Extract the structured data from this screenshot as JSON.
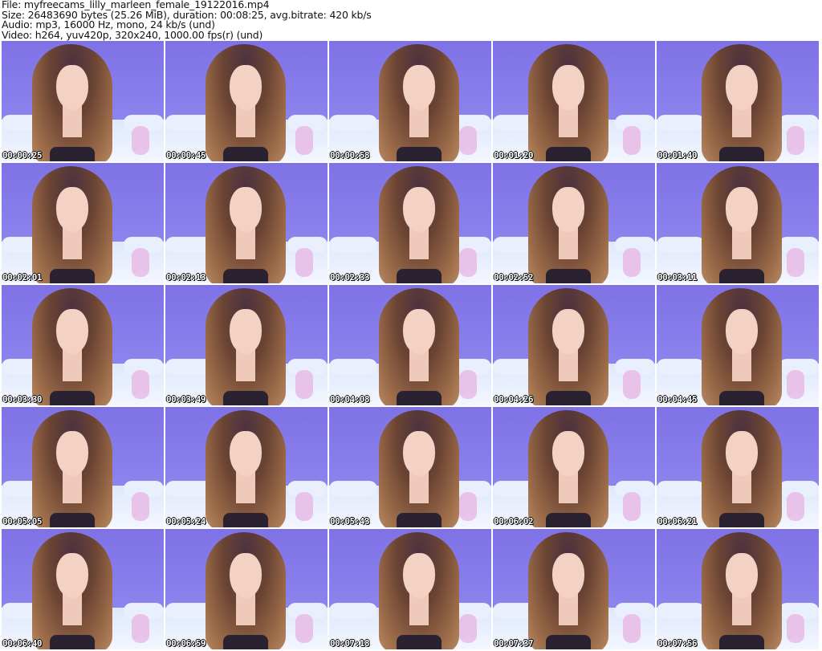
{
  "header": {
    "file": "File: myfreecams_lilly_marleen_female_19122016.mp4",
    "size": "Size: 26483690 bytes (25.26 MiB), duration: 00:08:25, avg.bitrate: 420 kb/s",
    "audio": "Audio: mp3, 16000 Hz, mono, 24 kb/s (und)",
    "video": "Video: h264, yuv420p, 320x240, 1000.00 fps(r) (und)"
  },
  "thumbnails": [
    {
      "timestamp": "00:00:25"
    },
    {
      "timestamp": "00:00:45"
    },
    {
      "timestamp": "00:00:58"
    },
    {
      "timestamp": "00:01:20"
    },
    {
      "timestamp": "00:01:40"
    },
    {
      "timestamp": "00:02:01"
    },
    {
      "timestamp": "00:02:13"
    },
    {
      "timestamp": "00:02:33"
    },
    {
      "timestamp": "00:02:52"
    },
    {
      "timestamp": "00:03:11"
    },
    {
      "timestamp": "00:03:30"
    },
    {
      "timestamp": "00:03:49"
    },
    {
      "timestamp": "00:04:08"
    },
    {
      "timestamp": "00:04:26"
    },
    {
      "timestamp": "00:04:45"
    },
    {
      "timestamp": "00:05:05"
    },
    {
      "timestamp": "00:05:24"
    },
    {
      "timestamp": "00:05:43"
    },
    {
      "timestamp": "00:06:02"
    },
    {
      "timestamp": "00:06:21"
    },
    {
      "timestamp": "00:06:40"
    },
    {
      "timestamp": "00:06:59"
    },
    {
      "timestamp": "00:07:18"
    },
    {
      "timestamp": "00:07:37"
    },
    {
      "timestamp": "00:07:56"
    }
  ]
}
